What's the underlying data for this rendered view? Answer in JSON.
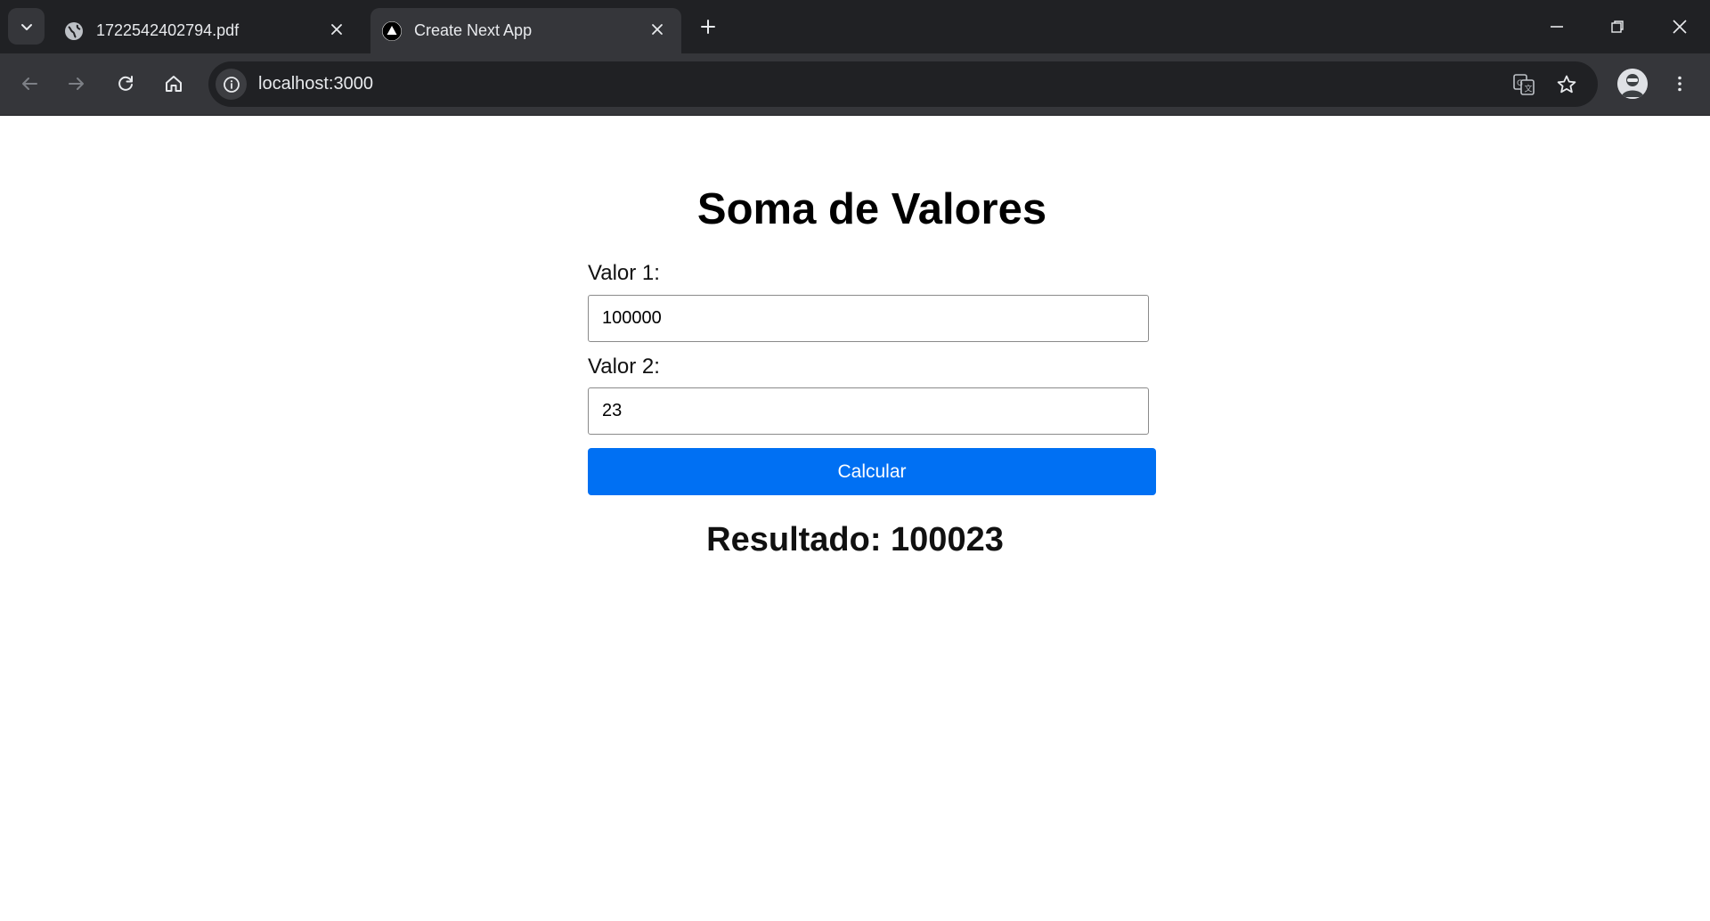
{
  "browser": {
    "tabs": [
      {
        "title": "1722542402794.pdf",
        "icon": "globe-icon",
        "active": false
      },
      {
        "title": "Create Next App",
        "icon": "nextjs-triangle-icon",
        "active": true
      }
    ],
    "url": "localhost:3000"
  },
  "page": {
    "title": "Soma de Valores",
    "field1": {
      "label": "Valor 1:",
      "value": "100000"
    },
    "field2": {
      "label": "Valor 2:",
      "value": "23"
    },
    "button_label": "Calcular",
    "result_text": "Resultado: 100023"
  },
  "colors": {
    "button_bg": "#0070f3",
    "chrome_dark": "#202124",
    "chrome_toolbar": "#35363a"
  }
}
